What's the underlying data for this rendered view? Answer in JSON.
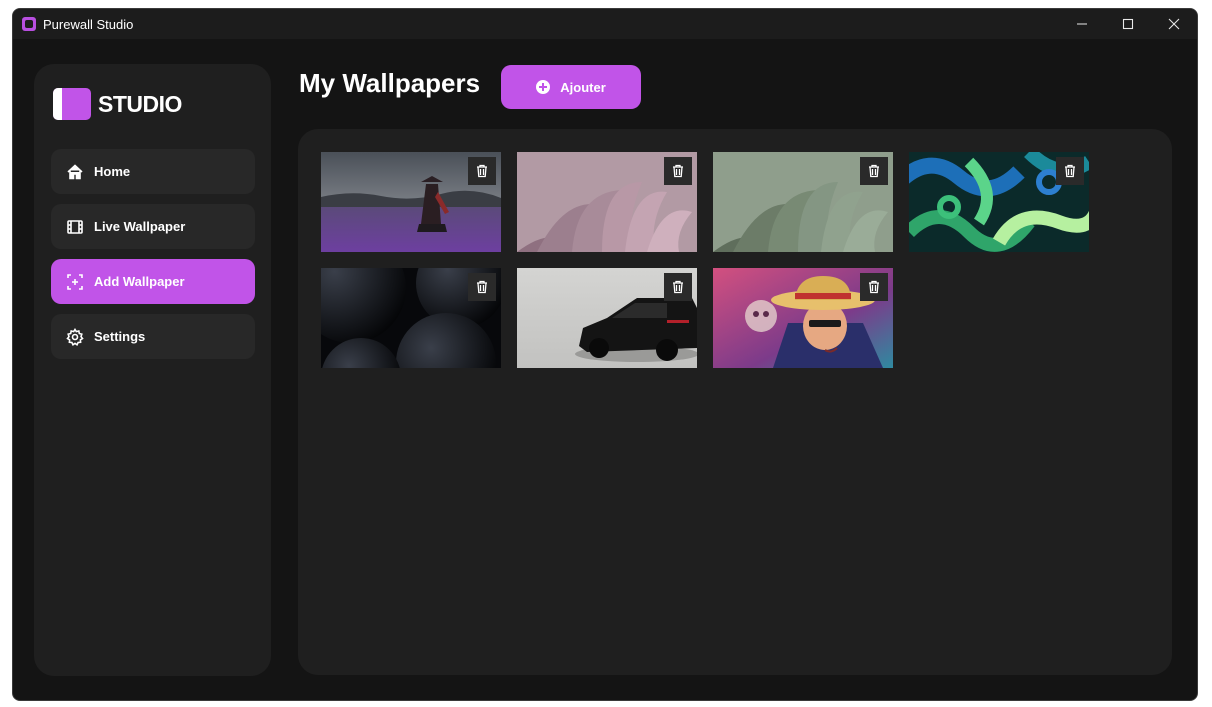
{
  "window": {
    "title": "Purewall Studio",
    "controls": {
      "minimize": "minimize-icon",
      "maximize": "maximize-icon",
      "close": "close-icon"
    }
  },
  "sidebar": {
    "logo_text": "STUDIO",
    "items": [
      {
        "label": "Home",
        "icon": "home-icon",
        "active": false
      },
      {
        "label": "Live Wallpaper",
        "icon": "film-icon",
        "active": false
      },
      {
        "label": "Add Wallpaper",
        "icon": "add-image-icon",
        "active": true
      },
      {
        "label": "Settings",
        "icon": "gear-icon",
        "active": false
      }
    ]
  },
  "main": {
    "title": "My Wallpapers",
    "add_button_label": "Ajouter"
  },
  "wallpapers": [
    {
      "subject": "purple-field-samurai",
      "delete_icon": "trash-icon"
    },
    {
      "subject": "pink-folded-petals",
      "delete_icon": "trash-icon"
    },
    {
      "subject": "green-folded-petals",
      "delete_icon": "trash-icon"
    },
    {
      "subject": "green-blue-swirls",
      "delete_icon": "trash-icon"
    },
    {
      "subject": "dark-spheres",
      "delete_icon": "trash-icon"
    },
    {
      "subject": "black-sports-car",
      "delete_icon": "trash-icon"
    },
    {
      "subject": "straw-hat-pirate",
      "delete_icon": "trash-icon"
    }
  ],
  "colors": {
    "accent": "#c154e8",
    "background": "#141414",
    "panel": "#1f1f1f",
    "nav_item": "#282828"
  }
}
